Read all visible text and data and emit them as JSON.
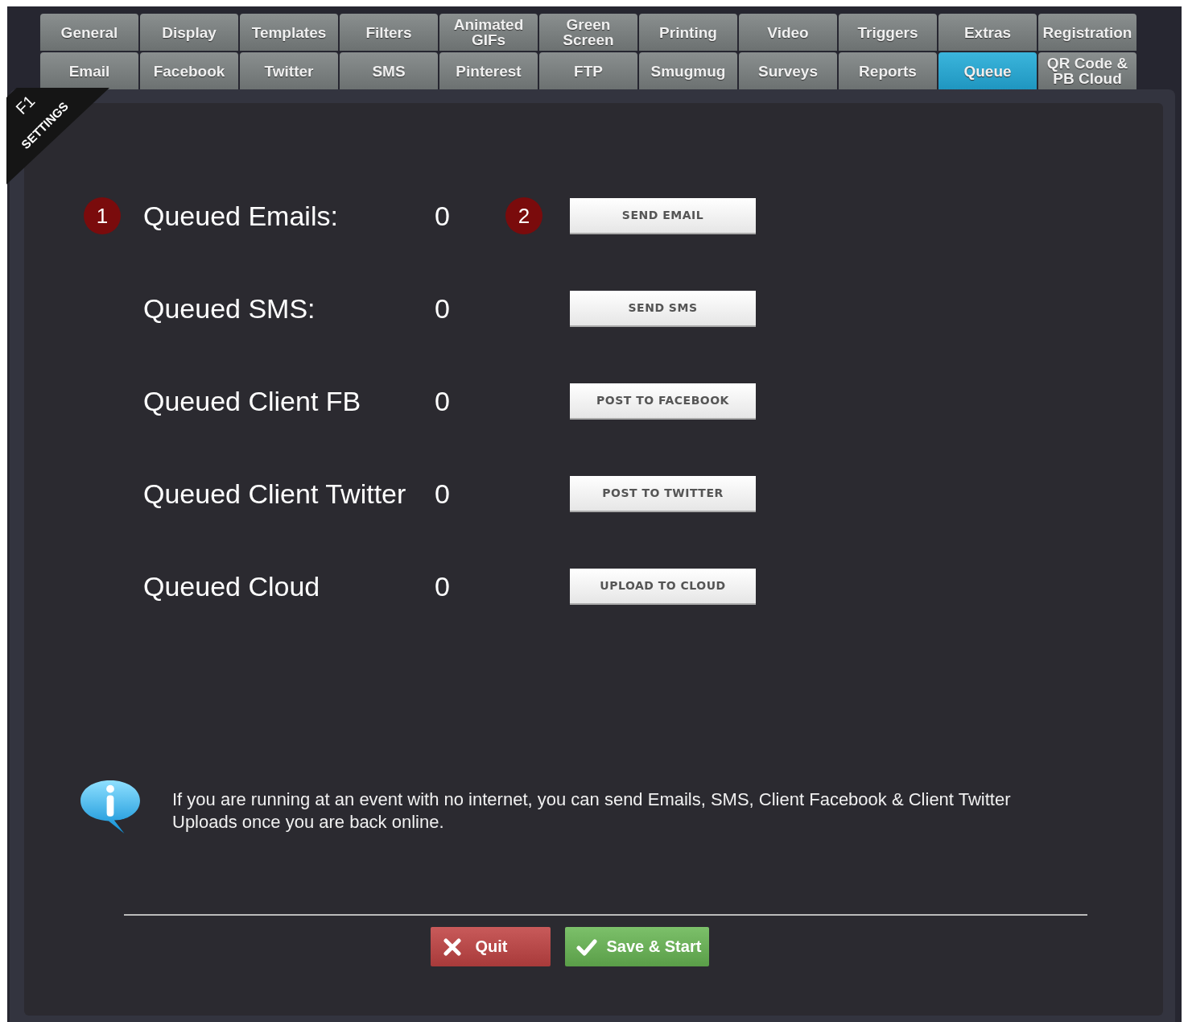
{
  "tab_rows": [
    {
      "tabs": [
        {
          "label": "General",
          "selected": false
        },
        {
          "label": "Display",
          "selected": false
        },
        {
          "label": "Templates",
          "selected": false
        },
        {
          "label": "Filters",
          "selected": false
        },
        {
          "label": "Animated\nGIFs",
          "selected": false
        },
        {
          "label": "Green\nScreen",
          "selected": false
        },
        {
          "label": "Printing",
          "selected": false
        },
        {
          "label": "Video",
          "selected": false
        },
        {
          "label": "Triggers",
          "selected": false
        },
        {
          "label": "Extras",
          "selected": false
        },
        {
          "label": "Registration",
          "selected": false
        }
      ]
    },
    {
      "tabs": [
        {
          "label": "Email",
          "selected": false
        },
        {
          "label": "Facebook",
          "selected": false
        },
        {
          "label": "Twitter",
          "selected": false
        },
        {
          "label": "SMS",
          "selected": false
        },
        {
          "label": "Pinterest",
          "selected": false
        },
        {
          "label": "FTP",
          "selected": false
        },
        {
          "label": "Smugmug",
          "selected": false
        },
        {
          "label": "Surveys",
          "selected": false
        },
        {
          "label": "Reports",
          "selected": false
        },
        {
          "label": "Queue",
          "selected": true
        },
        {
          "label": "QR Code &\nPB Cloud",
          "selected": false
        }
      ]
    }
  ],
  "ribbon": {
    "key": "F1",
    "label": "SETTINGS"
  },
  "queue_rows": [
    {
      "label": "Queued Emails:",
      "count": "0",
      "button": "SEND EMAIL",
      "label_badge": "1",
      "button_badge": "2"
    },
    {
      "label": "Queued SMS:",
      "count": "0",
      "button": "SEND SMS"
    },
    {
      "label": "Queued Client FB",
      "count": "0",
      "button": "POST TO FACEBOOK"
    },
    {
      "label": "Queued Client Twitter",
      "count": "0",
      "button": "POST TO TWITTER"
    },
    {
      "label": "Queued Cloud",
      "count": "0",
      "button": "UPLOAD TO CLOUD"
    }
  ],
  "info": "If you are running at an event with no internet, you can send Emails, SMS, Client Facebook & Client Twitter Uploads once you are back online.",
  "footer_buttons": [
    {
      "kind": "quit",
      "label": "Quit"
    },
    {
      "kind": "save",
      "label": "Save & Start"
    }
  ]
}
